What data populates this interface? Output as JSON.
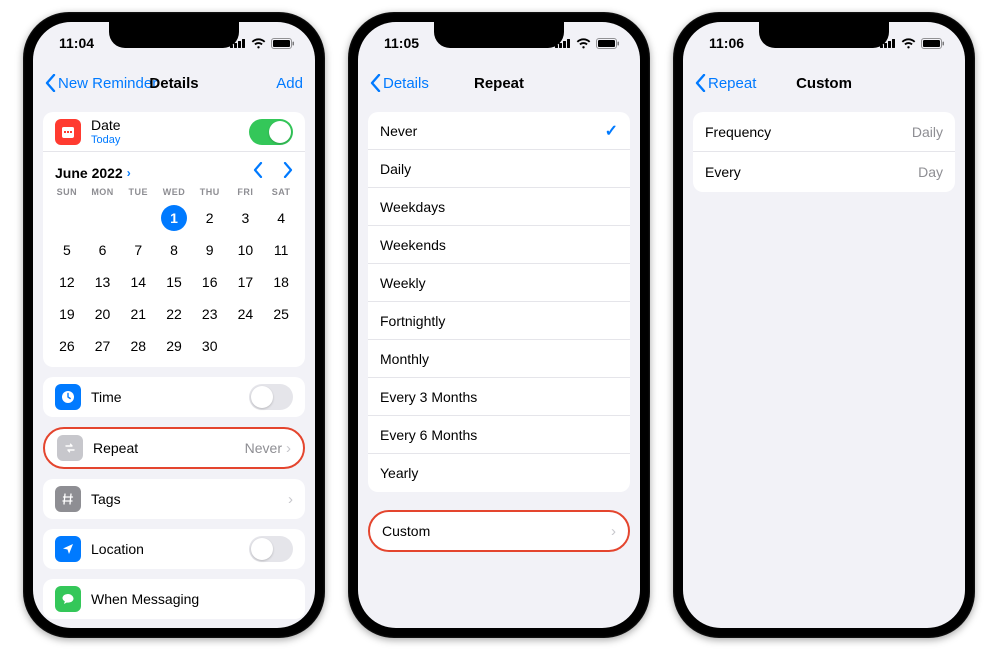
{
  "phones": [
    {
      "status_time": "11:04",
      "nav": {
        "back": "New Reminder",
        "title": "Details",
        "action": "Add"
      },
      "date_row": {
        "label": "Date",
        "sub": "Today",
        "toggle_on": true
      },
      "calendar": {
        "month_label": "June 2022",
        "dow": [
          "SUN",
          "MON",
          "TUE",
          "WED",
          "THU",
          "FRI",
          "SAT"
        ],
        "selected": 1,
        "leading_blanks": 3,
        "days": 30
      },
      "time_row": {
        "label": "Time",
        "toggle_on": false
      },
      "repeat_row": {
        "label": "Repeat",
        "value": "Never"
      },
      "tags_row": {
        "label": "Tags"
      },
      "location_row": {
        "label": "Location",
        "toggle_on": false
      },
      "messaging_row": {
        "label": "When Messaging"
      }
    },
    {
      "status_time": "11:05",
      "nav": {
        "back": "Details",
        "title": "Repeat"
      },
      "options": [
        {
          "label": "Never",
          "selected": true
        },
        {
          "label": "Daily"
        },
        {
          "label": "Weekdays"
        },
        {
          "label": "Weekends"
        },
        {
          "label": "Weekly"
        },
        {
          "label": "Fortnightly"
        },
        {
          "label": "Monthly"
        },
        {
          "label": "Every 3 Months"
        },
        {
          "label": "Every 6 Months"
        },
        {
          "label": "Yearly"
        }
      ],
      "custom_row": {
        "label": "Custom"
      }
    },
    {
      "status_time": "11:06",
      "nav": {
        "back": "Repeat",
        "title": "Custom"
      },
      "rows": [
        {
          "label": "Frequency",
          "value": "Daily"
        },
        {
          "label": "Every",
          "value": "Day"
        }
      ]
    }
  ]
}
